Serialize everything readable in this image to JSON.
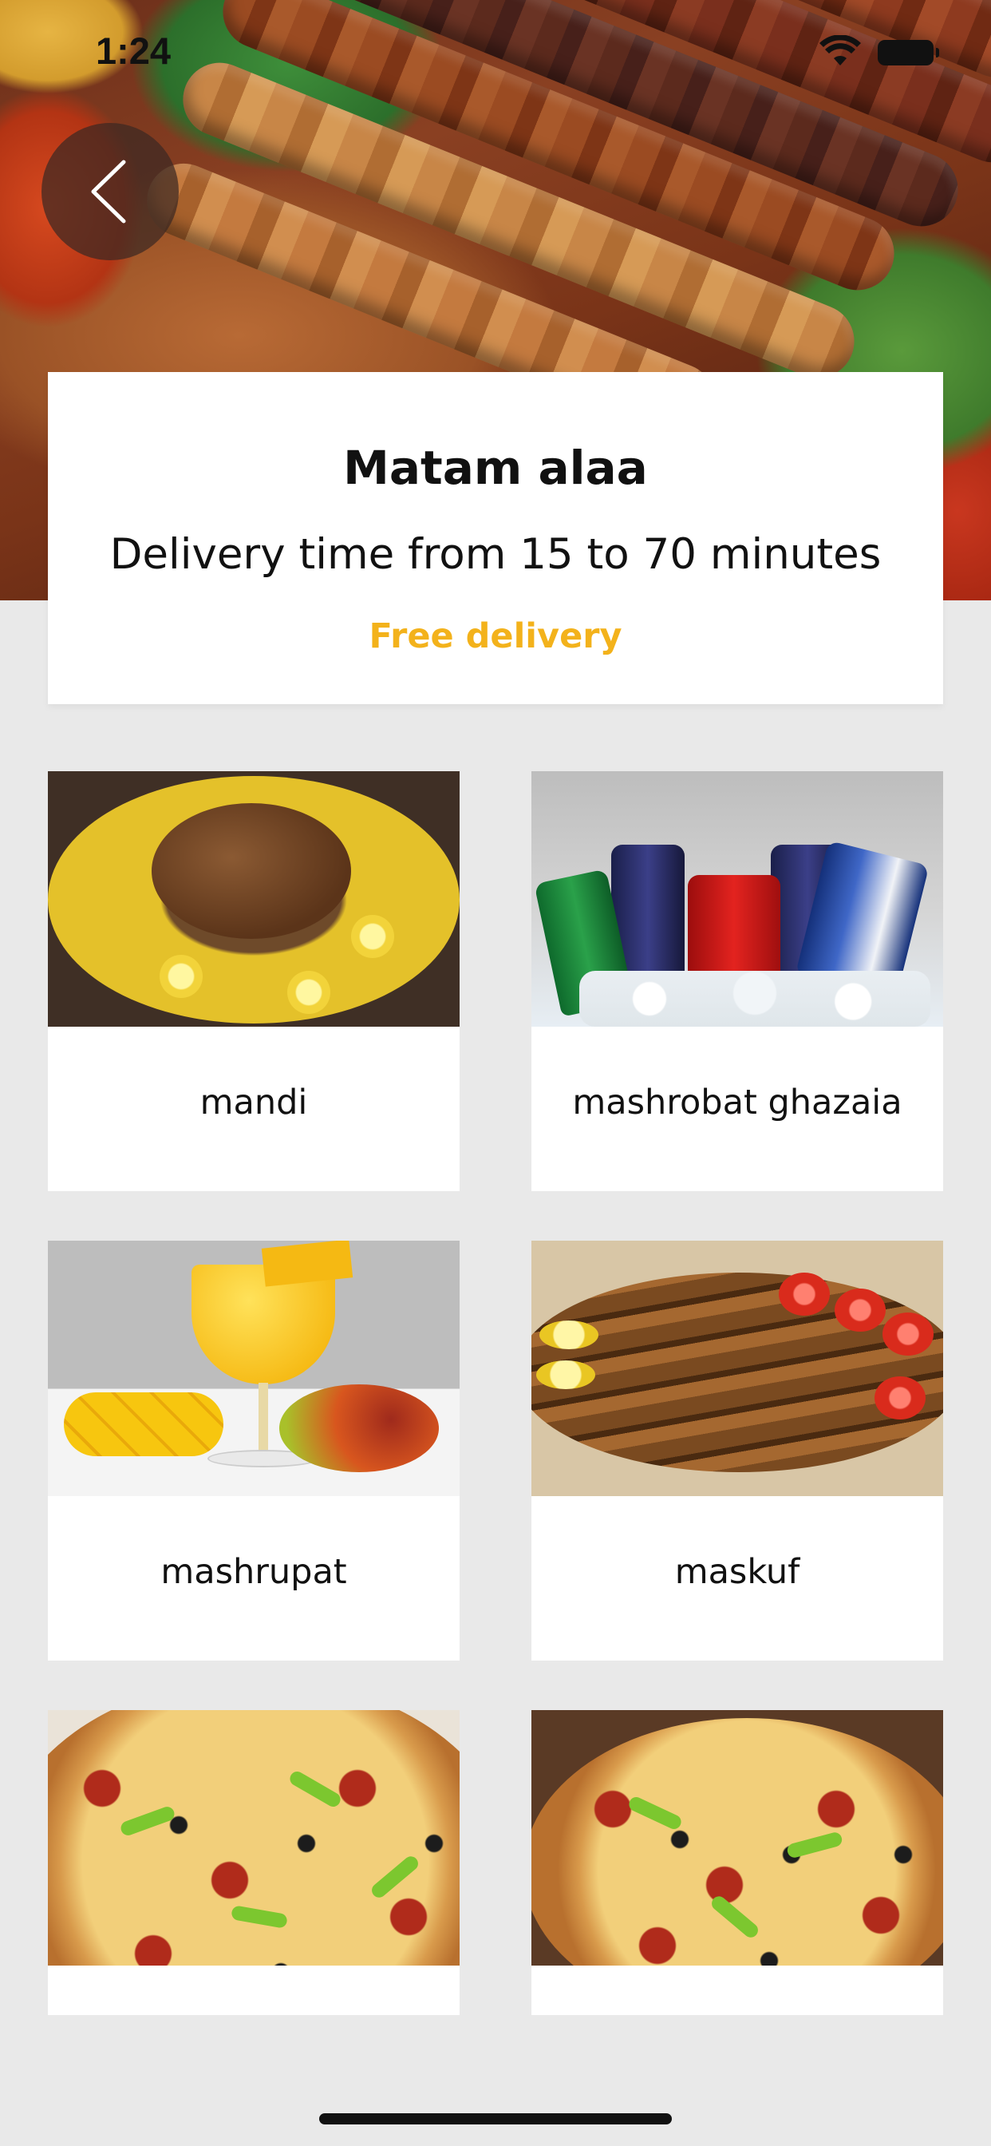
{
  "status_bar": {
    "time": "1:24",
    "icons": [
      "wifi-icon",
      "battery-icon"
    ]
  },
  "header": {
    "back_icon": "chevron-left-icon"
  },
  "restaurant": {
    "name": "Matam alaa",
    "delivery_time": "Delivery time from 15 to 70 minutes",
    "delivery_fee": "Free delivery",
    "accent_color": "#f3b21b"
  },
  "categories": [
    {
      "label": "mandi"
    },
    {
      "label": "mashrobat ghazaia"
    },
    {
      "label": "mashrupat"
    },
    {
      "label": "maskuf"
    },
    {
      "label": ""
    },
    {
      "label": ""
    }
  ]
}
